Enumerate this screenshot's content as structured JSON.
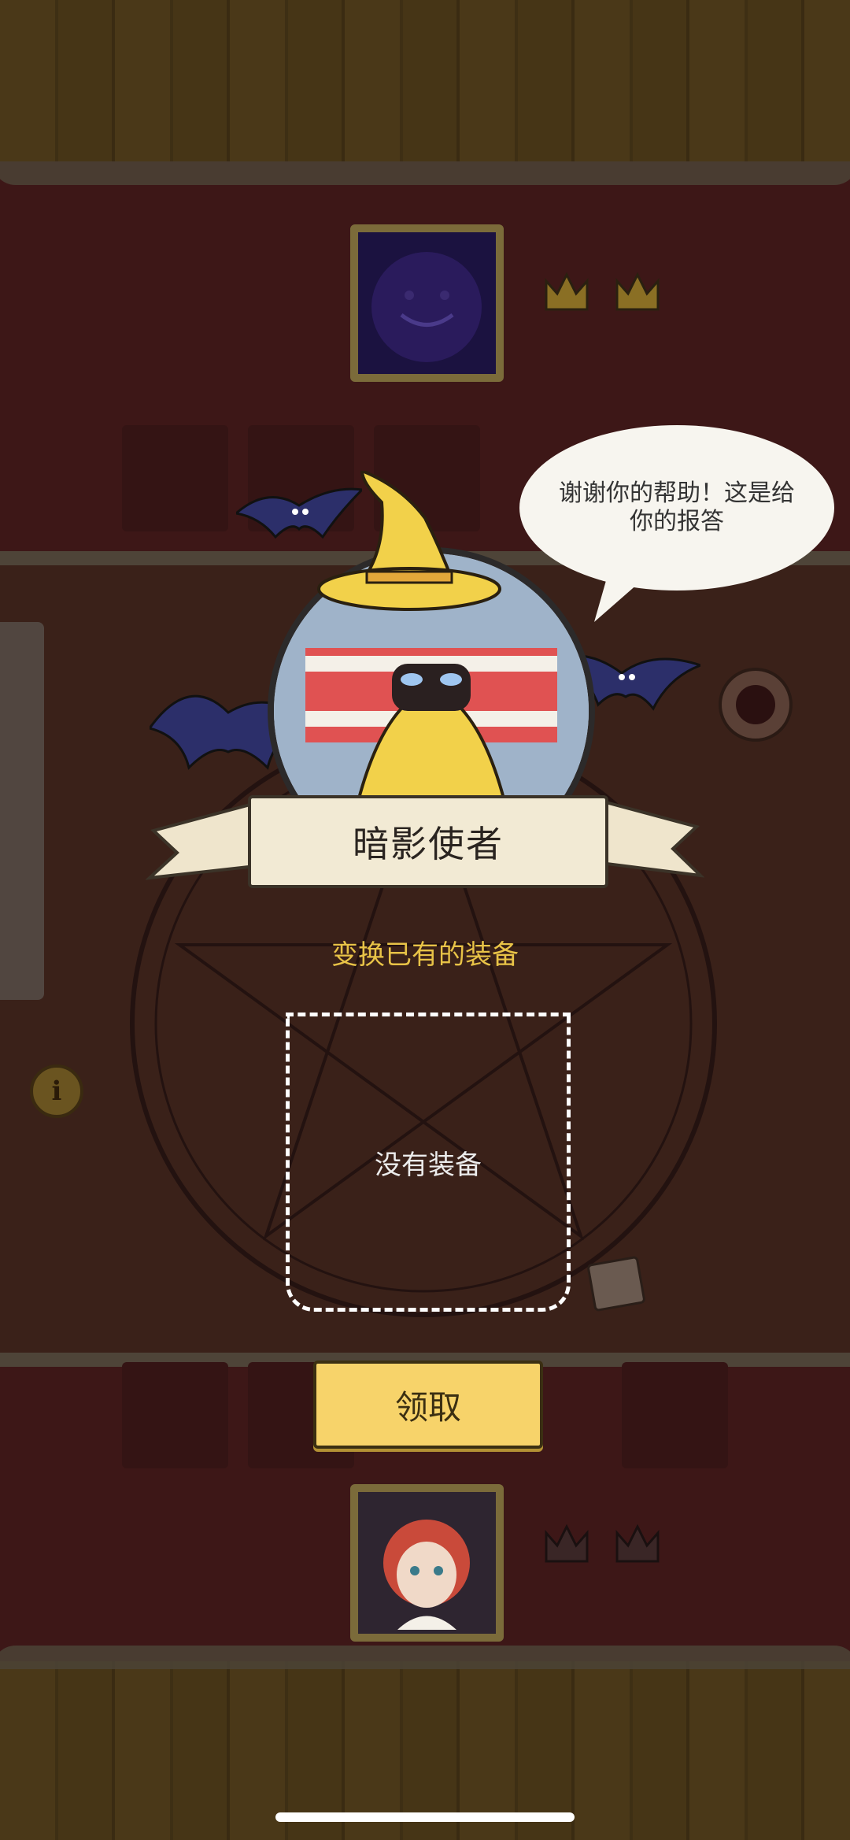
{
  "speech": {
    "text": "谢谢你的帮助！这是给你的报答"
  },
  "character": {
    "name": "暗影使者"
  },
  "prompt": {
    "text": "变换已有的装备"
  },
  "equipment_slot": {
    "empty_text": "没有装备"
  },
  "claim_button": {
    "label": "领取"
  },
  "colors": {
    "accent_yellow": "#e8c347",
    "button_fill": "#f7d36a",
    "wall": "#3d1717",
    "wood": "#4a3818"
  },
  "icons": [
    "bat-icon",
    "crown-icon",
    "info-icon",
    "pentagram-icon"
  ]
}
